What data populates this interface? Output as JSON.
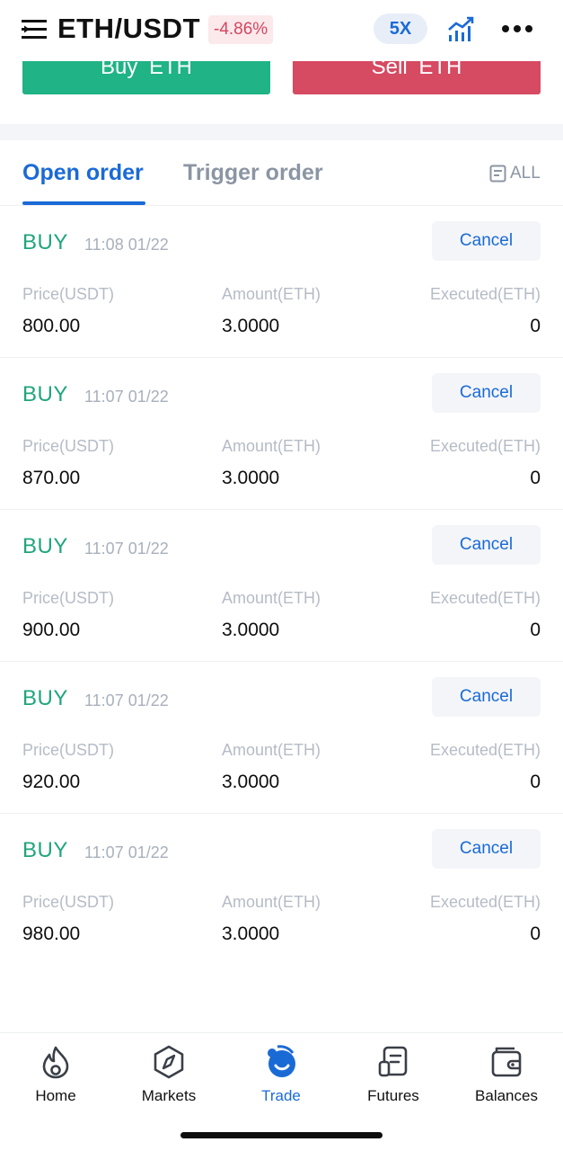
{
  "header": {
    "pair": "ETH/USDT",
    "change": "-4.86%",
    "leverage": "5X",
    "icons": [
      "menu-icon",
      "chart-icon",
      "more-icon"
    ]
  },
  "trade": {
    "buy_label": "Buy  ETH",
    "sell_label": "Sell  ETH"
  },
  "tabs": {
    "open_order": "Open order",
    "trigger_order": "Trigger order",
    "filter": "ALL"
  },
  "columns": {
    "price": "Price(USDT)",
    "amount": "Amount(ETH)",
    "executed": "Executed(ETH)"
  },
  "orders": [
    {
      "side": "BUY",
      "time": "11:08 01/22",
      "price": "800.00",
      "amount": "3.0000",
      "executed": "0",
      "cancel": "Cancel"
    },
    {
      "side": "BUY",
      "time": "11:07 01/22",
      "price": "870.00",
      "amount": "3.0000",
      "executed": "0",
      "cancel": "Cancel"
    },
    {
      "side": "BUY",
      "time": "11:07 01/22",
      "price": "900.00",
      "amount": "3.0000",
      "executed": "0",
      "cancel": "Cancel"
    },
    {
      "side": "BUY",
      "time": "11:07 01/22",
      "price": "920.00",
      "amount": "3.0000",
      "executed": "0",
      "cancel": "Cancel"
    },
    {
      "side": "BUY",
      "time": "11:07 01/22",
      "price": "980.00",
      "amount": "3.0000",
      "executed": "0",
      "cancel": "Cancel"
    }
  ],
  "nav": [
    {
      "label": "Home",
      "icon": "flame-icon"
    },
    {
      "label": "Markets",
      "icon": "compass-icon"
    },
    {
      "label": "Trade",
      "icon": "trade-icon",
      "active": true
    },
    {
      "label": "Futures",
      "icon": "document-icon"
    },
    {
      "label": "Balances",
      "icon": "wallet-icon"
    }
  ],
  "colors": {
    "accent": "#1a6ad6",
    "buy": "#1fb385",
    "sell": "#d64a62"
  }
}
